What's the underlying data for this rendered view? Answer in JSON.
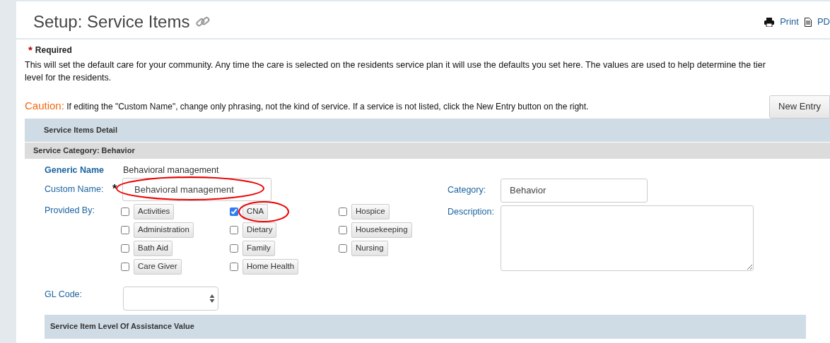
{
  "page_title": "Setup: Service Items",
  "header_actions": [
    {
      "kind": "print",
      "label": "Print"
    },
    {
      "kind": "pdf",
      "label": "PD"
    }
  ],
  "required_note": {
    "mark": "*",
    "text": "Required"
  },
  "intro": "This will set the default care for your community. Any time the care is selected on the residents service plan it will use the defaults you set here. The values are used to help determine the tier level for the residents.",
  "caution": {
    "label": "Caution:",
    "text": "If editing the \"Custom Name\", change only phrasing, not the kind of service. If a service is not listed, click the New Entry button on the right."
  },
  "new_entry_button": "New Entry",
  "section_title": "Service Items Detail",
  "category_header": "Service Category: Behavior",
  "form": {
    "generic_name": {
      "label": "Generic Name",
      "value": "Behavioral management"
    },
    "custom_name": {
      "label": "Custom Name:",
      "value": "Behavioral management",
      "required_mark": "*"
    },
    "provided_by": {
      "label": "Provided By:",
      "options": [
        {
          "label": "Activities",
          "checked": false
        },
        {
          "label": "Administration",
          "checked": false
        },
        {
          "label": "Bath Aid",
          "checked": false
        },
        {
          "label": "Care Giver",
          "checked": false
        },
        {
          "label": "CNA",
          "checked": true
        },
        {
          "label": "Dietary",
          "checked": false
        },
        {
          "label": "Family",
          "checked": false
        },
        {
          "label": "Home Health",
          "checked": false
        },
        {
          "label": "Hospice",
          "checked": false
        },
        {
          "label": "Housekeeping",
          "checked": false
        },
        {
          "label": "Nursing",
          "checked": false
        }
      ]
    },
    "category": {
      "label": "Category:",
      "value": "Behavior"
    },
    "description": {
      "label": "Description:"
    },
    "gl_code": {
      "label": "GL Code:"
    }
  },
  "subsection_title": "Service Item Level Of Assistance Value"
}
